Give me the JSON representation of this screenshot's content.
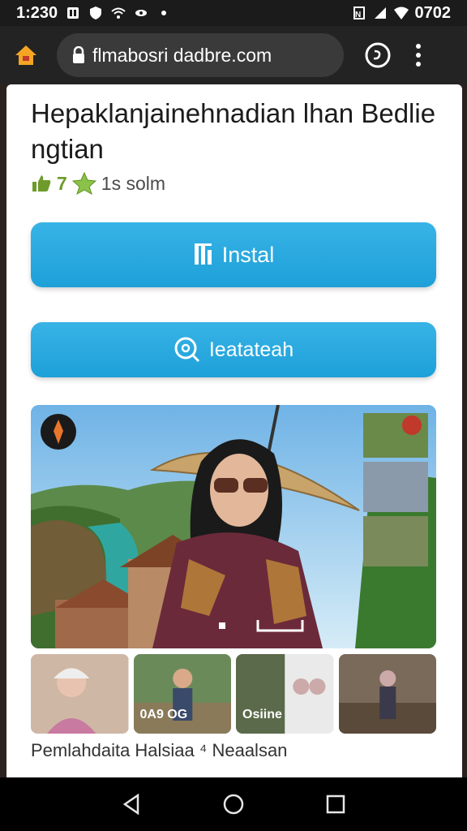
{
  "status_bar": {
    "time": "1:230",
    "right_text": "0702"
  },
  "browser": {
    "url": "flmabosri dadbre.com",
    "icons": [
      "home-icon",
      "lock-icon",
      "tab-switcher-icon",
      "overflow-menu-icon"
    ]
  },
  "app": {
    "title": "Hepaklanjainehnadian lhan Bedlie ngtian",
    "rating": "7",
    "size": "1s solm",
    "install_label": "Instal",
    "search_label": "Ieatateah",
    "caption": "Pemlahdaita Halsiaa ⁴ Neaalsan"
  },
  "thumbnails": [
    {
      "label": ""
    },
    {
      "label": "0A9 OG"
    },
    {
      "label": "Osiine"
    },
    {
      "label": ""
    }
  ],
  "colors": {
    "accent": "#1da0d8",
    "status_bg": "#1b1b1b",
    "url_bg": "#3a3a3a"
  }
}
